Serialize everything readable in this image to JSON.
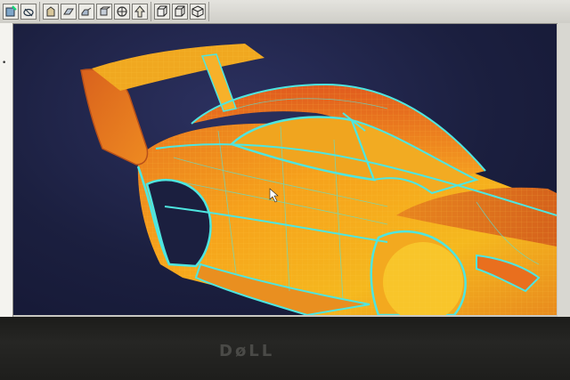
{
  "toolbar": {
    "groups": [
      {
        "buttons": [
          "new-part-icon",
          "sketch-icon"
        ]
      },
      {
        "buttons": [
          "pan-icon",
          "rotate-icon",
          "zoom-icon",
          "fit-icon",
          "view-orient-icon",
          "normal-view-icon"
        ]
      },
      {
        "buttons": [
          "shaded-icon",
          "wireframe-icon",
          "isometric-icon"
        ]
      }
    ]
  },
  "viewport": {
    "background": "#1b1f3f",
    "model": "car-body-surface-model",
    "surface_color": "#f0a21c",
    "edge_color": "#4ee6e0"
  },
  "monitor": {
    "brand": "DøLL"
  },
  "colors": {
    "toolbar_bg": "#dcdbd6",
    "bezel": "#1f1f1d"
  }
}
